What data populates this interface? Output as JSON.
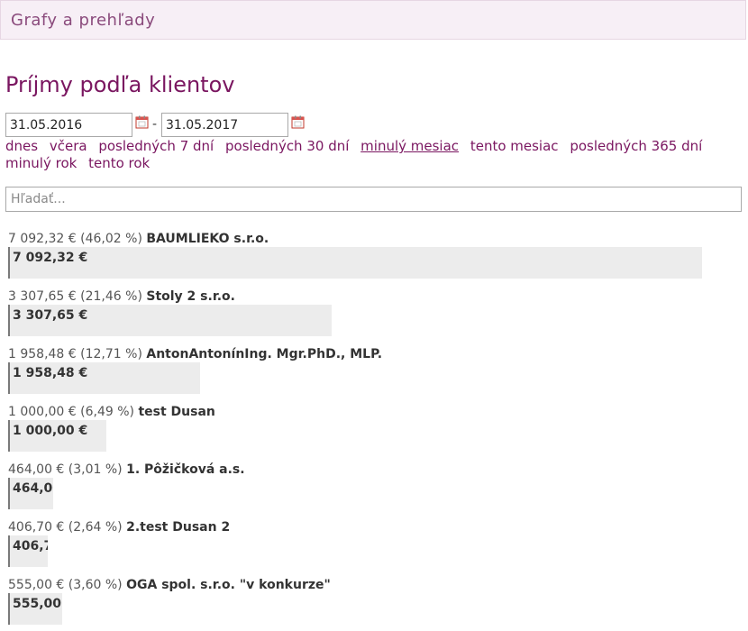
{
  "header": {
    "title": "Grafy a prehľady"
  },
  "page": {
    "title": "Príjmy podľa klientov"
  },
  "date_range": {
    "from": "31.05.2016",
    "separator": "-",
    "to": "31.05.2017"
  },
  "quick_ranges": [
    {
      "label": "dnes",
      "active": false
    },
    {
      "label": "včera",
      "active": false
    },
    {
      "label": "posledných 7 dní",
      "active": false
    },
    {
      "label": "posledných 30 dní",
      "active": false
    },
    {
      "label": "minulý mesiac",
      "active": true
    },
    {
      "label": "tento mesiac",
      "active": false
    },
    {
      "label": "posledných 365 dní",
      "active": false
    },
    {
      "label": "minulý rok",
      "active": false
    },
    {
      "label": "tento rok",
      "active": false
    }
  ],
  "search": {
    "placeholder": "Hľadať..."
  },
  "colors": {
    "accent": "#7a1660",
    "bar": "#ececec"
  },
  "clients": [
    {
      "amount": "7 092,32 €",
      "percent": "(46,02 %)",
      "name": "BAUMLIEKO s.r.o.",
      "share": 0.4602
    },
    {
      "amount": "3 307,65 €",
      "percent": "(21,46 %)",
      "name": "Stoly 2 s.r.o.",
      "share": 0.2146
    },
    {
      "amount": "1 958,48 €",
      "percent": "(12,71 %)",
      "name": "AntonAntonínIng. Mgr.PhD., MLP.",
      "share": 0.1271
    },
    {
      "amount": "1 000,00 €",
      "percent": "(6,49 %)",
      "name": "test Dusan",
      "share": 0.0649
    },
    {
      "amount": "464,00 €",
      "percent": "(3,01 %)",
      "name": "1. Pôžičková a.s.",
      "share": 0.0301
    },
    {
      "amount": "406,70 €",
      "percent": "(2,64 %)",
      "name": "2.test Dusan 2",
      "share": 0.0264
    },
    {
      "amount": "555,00 €",
      "percent": "(3,60 %)",
      "name": "OGA spol. s.r.o. \"v konkurze\"",
      "share": 0.036
    }
  ]
}
